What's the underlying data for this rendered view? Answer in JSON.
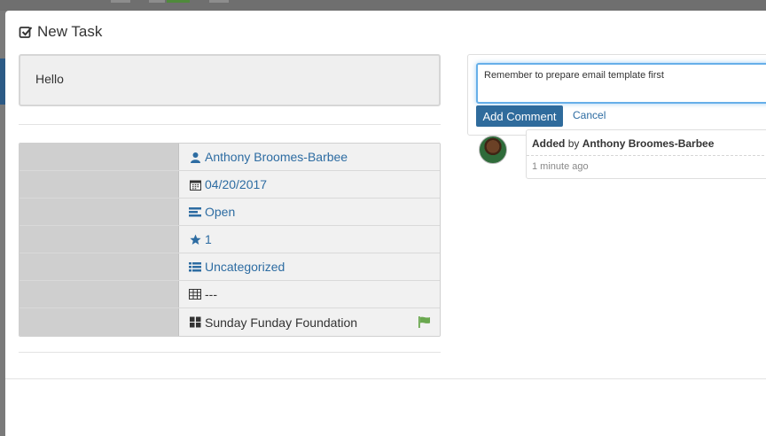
{
  "modal": {
    "title": "New Task",
    "description": "Hello"
  },
  "properties": [
    {
      "value": "Anthony Broomes-Barbee",
      "icon": "user-icon",
      "style": "link"
    },
    {
      "value": "04/20/2017",
      "icon": "calendar-icon",
      "style": "link"
    },
    {
      "value": "Open",
      "icon": "status-icon",
      "style": "link"
    },
    {
      "value": "1",
      "icon": "star-icon",
      "style": "link"
    },
    {
      "value": "Uncategorized",
      "icon": "list-icon",
      "style": "link"
    },
    {
      "value": "---",
      "icon": "table-icon",
      "style": "plain"
    },
    {
      "value": "Sunday Funday Foundation",
      "icon": "grid-icon",
      "style": "plain",
      "flag": "flag-icon"
    }
  ],
  "comment": {
    "input_value": "Remember to prepare email template first",
    "add_label": "Add Comment",
    "cancel_label": "Cancel"
  },
  "activity": {
    "action": "Added",
    "by": "by",
    "user": "Anthony Broomes-Barbee",
    "time": "1 minute ago"
  },
  "colors": {
    "link": "#2d6ca2",
    "button": "#2f6b9c",
    "flag": "#6aa84f"
  }
}
